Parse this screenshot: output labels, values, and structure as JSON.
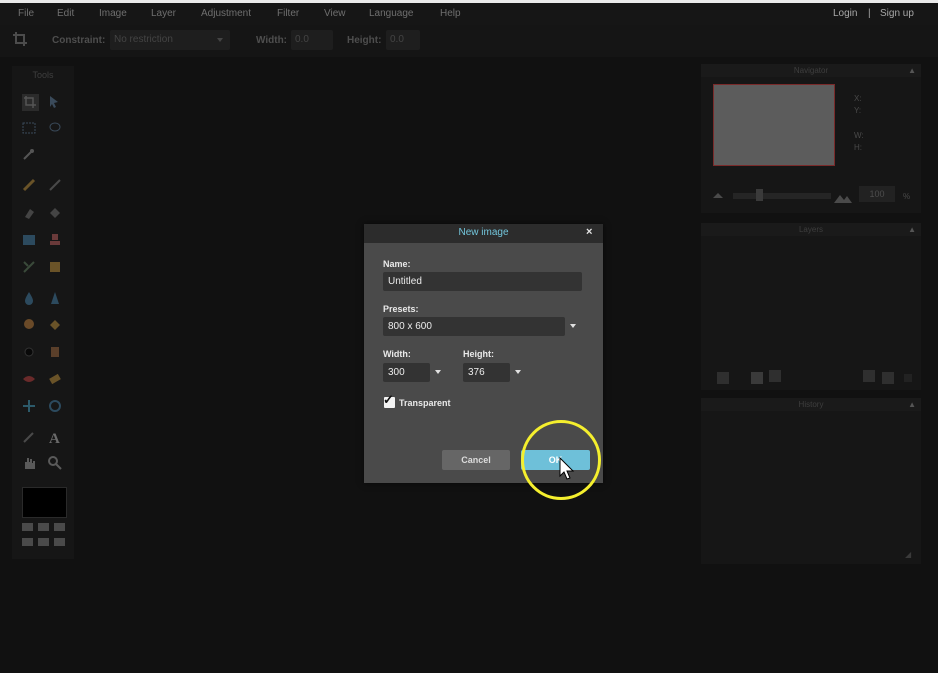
{
  "menu": {
    "items": [
      {
        "label": "File"
      },
      {
        "label": "Edit"
      },
      {
        "label": "Image"
      },
      {
        "label": "Layer"
      },
      {
        "label": "Adjustment"
      },
      {
        "label": "Filter"
      },
      {
        "label": "View"
      },
      {
        "label": "Language"
      },
      {
        "label": "Help"
      }
    ],
    "login": "Login",
    "separator": "|",
    "signup": "Sign up"
  },
  "options_bar": {
    "constraint_label": "Constraint:",
    "constraint_value": "No restriction",
    "width_label": "Width:",
    "width_value": "0.0",
    "height_label": "Height:",
    "height_value": "0.0"
  },
  "tools_panel": {
    "title": "Tools"
  },
  "navigator": {
    "title": "Navigator",
    "x_label": "X:",
    "y_label": "Y:",
    "w_label": "W:",
    "h_label": "H:",
    "zoom_value": "100"
  },
  "layers": {
    "title": "Layers"
  },
  "history": {
    "title": "History"
  },
  "dialog": {
    "title": "New image",
    "close_glyph": "×",
    "name_label": "Name:",
    "name_value": "Untitled",
    "presets_label": "Presets:",
    "presets_value": "800 x 600",
    "width_label": "Width:",
    "width_value": "300",
    "height_label": "Height:",
    "height_value": "376",
    "transparent_label": "Transparent",
    "transparent_checked": true,
    "cancel_label": "Cancel",
    "ok_label": "OK"
  },
  "colors": {
    "accent": "#6ec0d9",
    "highlight_ring": "#f5ef2e",
    "dialog_bg": "#4a4a4a",
    "app_bg": "#111111"
  }
}
